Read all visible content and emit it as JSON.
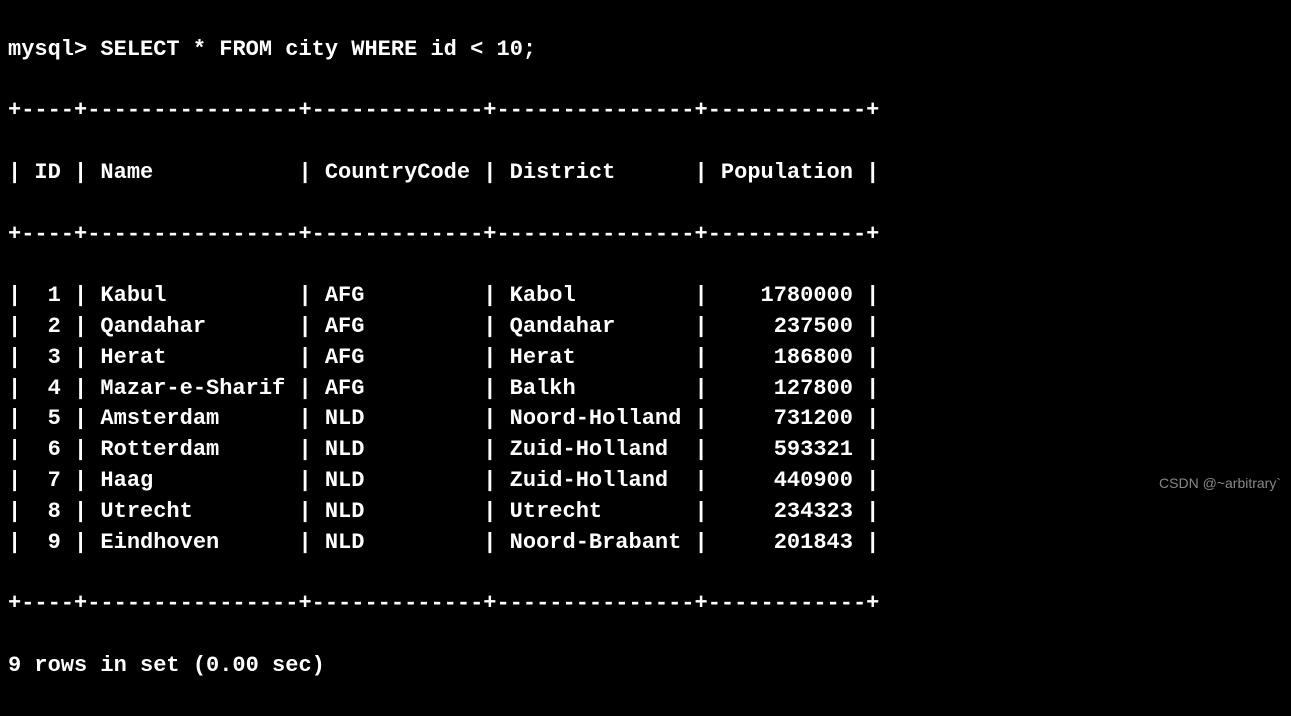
{
  "prompt": "mysql>",
  "query": "SELECT * FROM city WHERE id < 10;",
  "columns": [
    "ID",
    "Name",
    "CountryCode",
    "District",
    "Population"
  ],
  "rows": [
    {
      "id": "1",
      "name": "Kabul",
      "country": "AFG",
      "district": "Kabol",
      "population": "1780000"
    },
    {
      "id": "2",
      "name": "Qandahar",
      "country": "AFG",
      "district": "Qandahar",
      "population": "237500"
    },
    {
      "id": "3",
      "name": "Herat",
      "country": "AFG",
      "district": "Herat",
      "population": "186800"
    },
    {
      "id": "4",
      "name": "Mazar-e-Sharif",
      "country": "AFG",
      "district": "Balkh",
      "population": "127800"
    },
    {
      "id": "5",
      "name": "Amsterdam",
      "country": "NLD",
      "district": "Noord-Holland",
      "population": "731200"
    },
    {
      "id": "6",
      "name": "Rotterdam",
      "country": "NLD",
      "district": "Zuid-Holland",
      "population": "593321"
    },
    {
      "id": "7",
      "name": "Haag",
      "country": "NLD",
      "district": "Zuid-Holland",
      "population": "440900"
    },
    {
      "id": "8",
      "name": "Utrecht",
      "country": "NLD",
      "district": "Utrecht",
      "population": "234323"
    },
    {
      "id": "9",
      "name": "Eindhoven",
      "country": "NLD",
      "district": "Noord-Brabant",
      "population": "201843"
    }
  ],
  "footer": "9 rows in set (0.00 sec)",
  "border_sep": "+----+----------------+-------------+---------------+------------+",
  "col_widths": {
    "id": 4,
    "name": 16,
    "country": 13,
    "district": 15,
    "population": 12
  },
  "watermark": "CSDN @~arbitrary`",
  "chart_data": {
    "type": "table",
    "columns": [
      "ID",
      "Name",
      "CountryCode",
      "District",
      "Population"
    ],
    "data": [
      [
        1,
        "Kabul",
        "AFG",
        "Kabol",
        1780000
      ],
      [
        2,
        "Qandahar",
        "AFG",
        "Qandahar",
        237500
      ],
      [
        3,
        "Herat",
        "AFG",
        "Herat",
        186800
      ],
      [
        4,
        "Mazar-e-Sharif",
        "AFG",
        "Balkh",
        127800
      ],
      [
        5,
        "Amsterdam",
        "NLD",
        "Noord-Holland",
        731200
      ],
      [
        6,
        "Rotterdam",
        "NLD",
        "Zuid-Holland",
        593321
      ],
      [
        7,
        "Haag",
        "NLD",
        "Zuid-Holland",
        440900
      ],
      [
        8,
        "Utrecht",
        "NLD",
        "Utrecht",
        234323
      ],
      [
        9,
        "Eindhoven",
        "NLD",
        "Noord-Brabant",
        201843
      ]
    ]
  }
}
